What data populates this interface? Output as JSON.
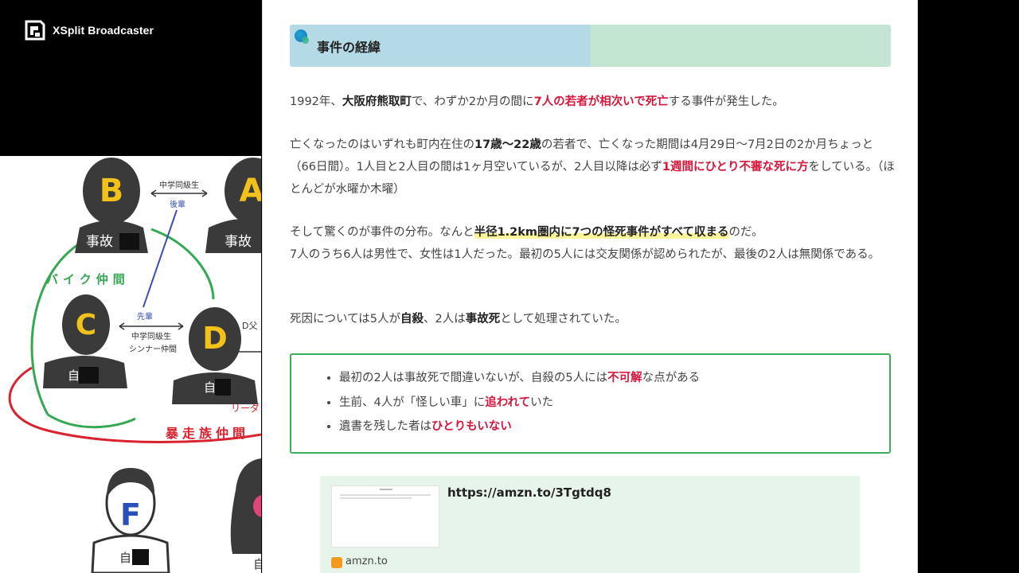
{
  "app": {
    "name": "XSplit Broadcaster",
    "logo_icon": "xsplit-logo-icon"
  },
  "diagram": {
    "persons": {
      "b": {
        "letter": "B",
        "caption": "事故"
      },
      "a": {
        "letter": "A",
        "caption": "事故"
      },
      "c": {
        "letter": "C",
        "caption": "自"
      },
      "d": {
        "letter": "D",
        "caption": "自"
      },
      "f": {
        "letter": "F",
        "caption": "自"
      },
      "g": {
        "caption": "自"
      }
    },
    "labels": {
      "ab_relation": "中学同級生",
      "kohai": "後輩",
      "senpai": "先輩",
      "cd_relation_1": "中学同級生",
      "cd_relation_2": "シンナー仲間",
      "bike_group": "バイク仲間",
      "gang_group": "暴走族仲間",
      "d_father": "D父",
      "leader": "リーダ"
    },
    "colors": {
      "person": "#3a3a3a",
      "letter": "#f2c21b",
      "green": "#35a852",
      "red": "#d9232f",
      "blue": "#3a4fb0"
    }
  },
  "article": {
    "heading": "事件の経緯",
    "p1": {
      "t1": "1992年、",
      "b1": "大阪府熊取町",
      "t2": "で、わずか2か月の間に",
      "r1": "7人の若者が相次いで死亡",
      "t3": "する事件が発生した。"
    },
    "p2": {
      "t1": "亡くなったのはいずれも町内在住の",
      "b1": "17歳～22歳",
      "t2": "の若者で、亡くなった期間は4月29日～7月2日の2か月ちょっと（66日間）。1人目と2人目の間は1ヶ月空いているが、2人目以降は必ず",
      "r1": "1週間にひとり不審な死に方",
      "t3": "をしている。（ほとんどが水曜か木曜）"
    },
    "p3": {
      "t1": "そして驚くのが事件の分布。なんと",
      "hl": "半径1.2km圏内に7つの怪死事件がすべて収まる",
      "t2": "のだ。",
      "t3": "7人のうち6人は男性で、女性は1人だった。最初の5人には交友関係が認められたが、最後の2人は無関係である。"
    },
    "p4": {
      "t1": "死因については5人が",
      "b1": "自殺",
      "t2": "、2人は",
      "b2": "事故死",
      "t3": "として処理されていた。"
    },
    "points": [
      {
        "t1": "最初の2人は事故死で間違いないが、自殺の5人には",
        "r": "不可解",
        "t2": "な点がある"
      },
      {
        "t1": "生前、4人が「怪しい車」に",
        "r": "追われて",
        "t2": "いた"
      },
      {
        "t1": "遺書を残した者は",
        "r": "ひとりもいない",
        "t2": ""
      }
    ],
    "link_card": {
      "url": "https://amzn.to/3Tgtdq8",
      "domain": "amzn.to",
      "favicon": "amazon-favicon-icon"
    },
    "colors": {
      "accent_red": "#d6173c",
      "box_border": "#3bb05a",
      "card_bg": "#e7f4ea"
    }
  }
}
